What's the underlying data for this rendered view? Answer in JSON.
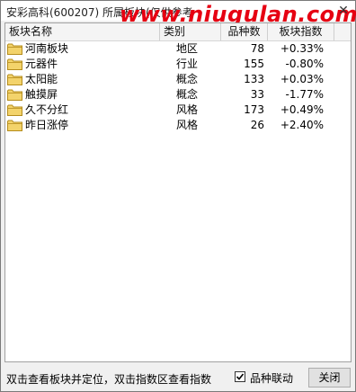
{
  "window": {
    "title": "安彩高科(600207)  所属板块(仅供参考",
    "watermark": "www.niugulan.com",
    "close_glyph": "✕"
  },
  "table": {
    "columns": [
      "板块名称",
      "类别",
      "品种数",
      "板块指数"
    ],
    "rows": [
      {
        "name": "河南板块",
        "category": "地区",
        "count": "78",
        "index": "+0.33%"
      },
      {
        "name": "元器件",
        "category": "行业",
        "count": "155",
        "index": "-0.80%"
      },
      {
        "name": "太阳能",
        "category": "概念",
        "count": "133",
        "index": "+0.03%"
      },
      {
        "name": "触摸屏",
        "category": "概念",
        "count": "33",
        "index": "-1.77%"
      },
      {
        "name": "久不分红",
        "category": "风格",
        "count": "173",
        "index": "+0.49%"
      },
      {
        "name": "昨日涨停",
        "category": "风格",
        "count": "26",
        "index": "+2.40%"
      }
    ]
  },
  "footer": {
    "hint": "双击查看板块并定位，双击指数区查看指数",
    "linkage_label": "品种联动",
    "linkage_checked": true,
    "close_label": "关闭"
  }
}
